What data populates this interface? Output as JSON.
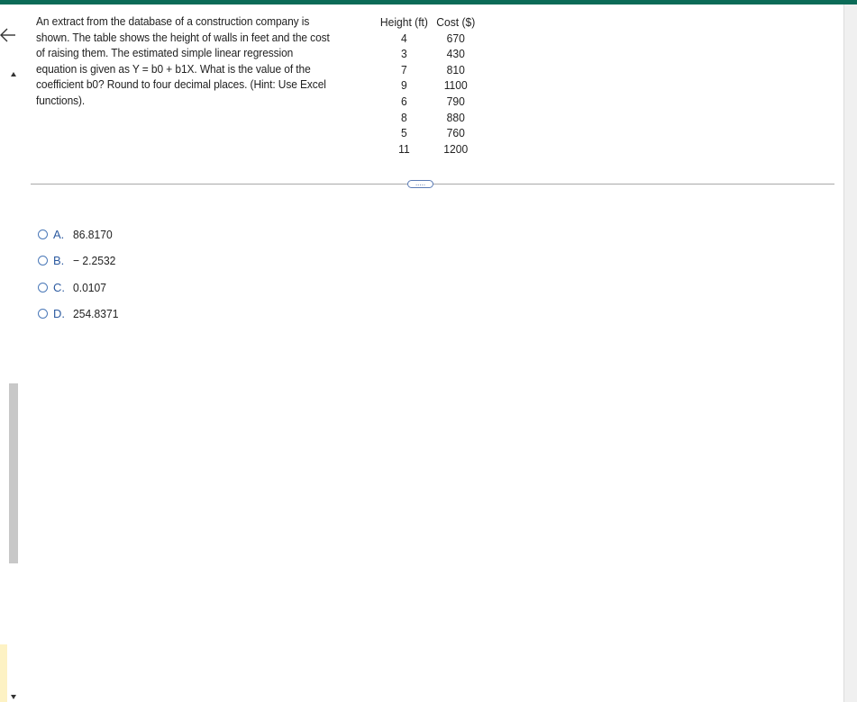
{
  "question": {
    "text": "An extract from the database of a construction company is shown. The table shows the height of walls in feet and the cost of raising them. The estimated simple linear regression equation is given as Y = b0 + b1X. What is the value of the coefficient b0? Round to four decimal places. (Hint: Use Excel functions)."
  },
  "table": {
    "headers": [
      "Height (ft)",
      "Cost ($)"
    ],
    "rows": [
      [
        "4",
        "670"
      ],
      [
        "3",
        "430"
      ],
      [
        "7",
        "810"
      ],
      [
        "9",
        "1100"
      ],
      [
        "6",
        "790"
      ],
      [
        "8",
        "880"
      ],
      [
        "5",
        "760"
      ],
      [
        "11",
        "1200"
      ]
    ]
  },
  "expand_button": {
    "label": "....."
  },
  "options": [
    {
      "letter": "A.",
      "value": "86.8170"
    },
    {
      "letter": "B.",
      "value": "− 2.2532"
    },
    {
      "letter": "C.",
      "value": "0.0107"
    },
    {
      "letter": "D.",
      "value": "254.8371"
    }
  ],
  "colors": {
    "top_bar": "#0b6b57",
    "option_letter": "#2c5aa0",
    "radio_border": "#4a78b8"
  }
}
